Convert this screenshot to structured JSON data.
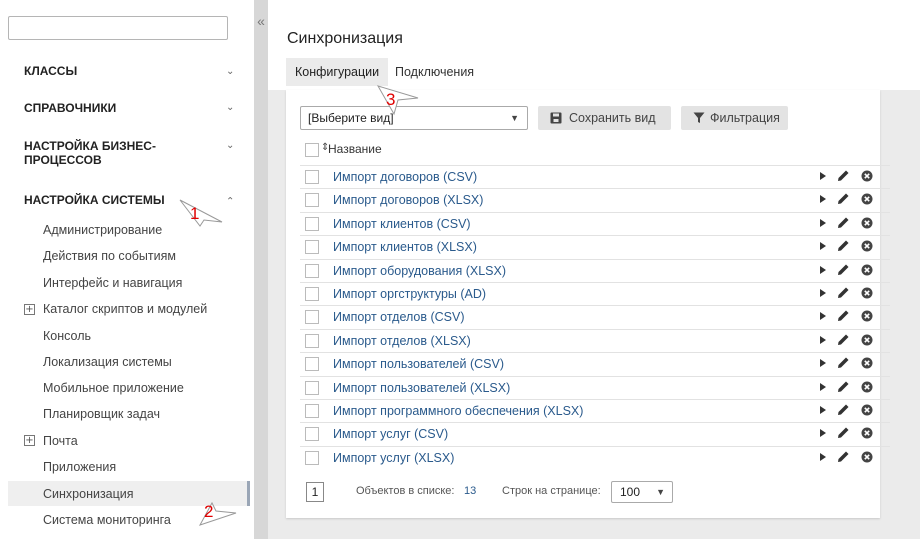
{
  "sidebar": {
    "search_value": "",
    "sections": [
      {
        "label": "КЛАССЫ"
      },
      {
        "label": "СПРАВОЧНИКИ"
      },
      {
        "label": "НАСТРОЙКА БИЗНЕС-ПРОЦЕССОВ"
      },
      {
        "label": "НАСТРОЙКА СИСТЕМЫ"
      }
    ],
    "items": [
      {
        "label": "Администрирование"
      },
      {
        "label": "Действия по событиям"
      },
      {
        "label": "Интерфейс и навигация"
      },
      {
        "label": "Каталог скриптов и модулей"
      },
      {
        "label": "Консоль"
      },
      {
        "label": "Локализация системы"
      },
      {
        "label": "Мобильное приложение"
      },
      {
        "label": "Планировщик задач"
      },
      {
        "label": "Почта"
      },
      {
        "label": "Приложения"
      },
      {
        "label": "Синхронизация"
      },
      {
        "label": "Система мониторинга"
      }
    ],
    "expand_glyph": "+",
    "collapse_glyph": "«"
  },
  "main": {
    "title": "Синхронизация",
    "tabs": [
      {
        "label": "Конфигурации"
      },
      {
        "label": "Подключения"
      }
    ],
    "toolbar": {
      "view_select": "[Выберите вид]",
      "save_label": "Сохранить вид",
      "filter_label": "Фильтрация"
    },
    "table": {
      "column_header": "Название",
      "rows": [
        {
          "name": "Импорт договоров (CSV)"
        },
        {
          "name": "Импорт договоров (XLSX)"
        },
        {
          "name": "Импорт клиентов (CSV)"
        },
        {
          "name": "Импорт клиентов (XLSX)"
        },
        {
          "name": "Импорт оборудования (XLSX)"
        },
        {
          "name": "Импорт оргструктуры (AD)"
        },
        {
          "name": "Импорт отделов (CSV)"
        },
        {
          "name": "Импорт отделов (XLSX)"
        },
        {
          "name": "Импорт пользователей (CSV)"
        },
        {
          "name": "Импорт пользователей (XLSX)"
        },
        {
          "name": "Импорт программного обеспечения (XLSX)"
        },
        {
          "name": "Импорт услуг (CSV)"
        },
        {
          "name": "Импорт услуг (XLSX)"
        }
      ]
    },
    "footer": {
      "page": "1",
      "count_label": "Объектов в списке:",
      "count": "13",
      "rows_label": "Строк на странице:",
      "rows_per_page": "100"
    }
  },
  "callouts": [
    "1",
    "2",
    "3"
  ],
  "colors": {
    "link": "#2a5a8c",
    "callout": "#e00000",
    "active_tab_bg": "#ebebeb"
  }
}
